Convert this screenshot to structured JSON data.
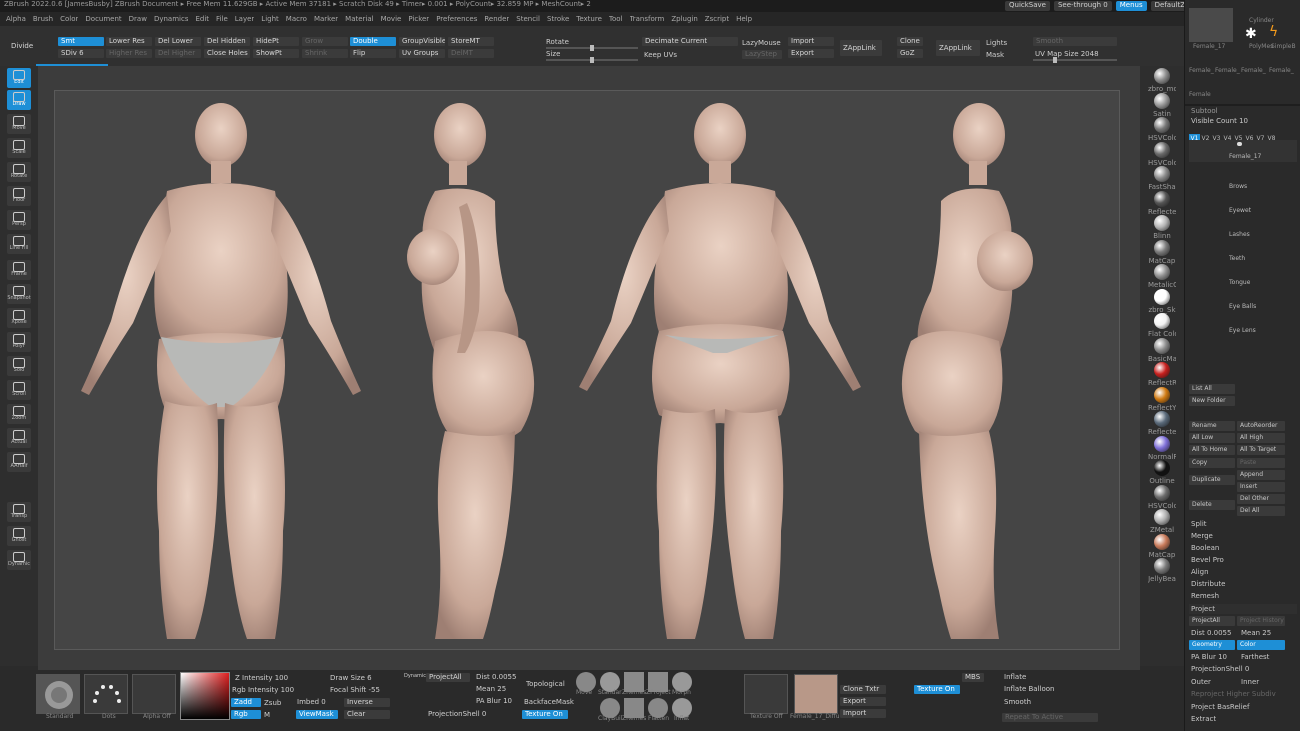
{
  "titlebar": {
    "title": "ZBrush 2022.0.6 [JamesBusby]   ZBrush Document      ▸ Free Mem 11.629GB ▸ Active Mem 37181 ▸ Scratch Disk 49 ▸ Timer▸ 0.001 ▸ PolyCount▸ 32.859 MP ▸ MeshCount▸ 2",
    "quicksave": "QuickSave",
    "seethrough": "See-through  0",
    "menus": "Menus",
    "script": "DefaultZScript"
  },
  "menubar": [
    "Alpha",
    "Brush",
    "Color",
    "Document",
    "Draw",
    "Dynamics",
    "Edit",
    "File",
    "Layer",
    "Light",
    "Macro",
    "Marker",
    "Material",
    "Movie",
    "Picker",
    "Preferences",
    "Render",
    "Stencil",
    "Stroke",
    "Texture",
    "Tool",
    "Transform",
    "Zplugin",
    "Zscript",
    "Help"
  ],
  "shelf": {
    "divide": "Divide",
    "smt": "Smt",
    "sdiv": "SDiv 6",
    "lower_res": "Lower Res",
    "higher_res": "Higher Res",
    "del_lower": "Del Lower",
    "del_higher": "Del Higher",
    "del_hidden": "Del Hidden",
    "close_holes": "Close Holes",
    "hidept": "HidePt",
    "showpt": "ShowPt",
    "grow": "Grow",
    "shrink": "Shrink",
    "double": "Double",
    "flip": "Flip",
    "groupvisible": "GroupVisible",
    "uvgroups": "Uv Groups",
    "storemt": "StoreMT",
    "delmt": "DelMT",
    "rotate": "Rotate",
    "size": "Size",
    "decimate": "Decimate Current",
    "keepuvs": "Keep UVs",
    "lazymouse": "LazyMouse",
    "lazystep": "LazyStep",
    "import": "Import",
    "export": "Export",
    "zapplink": "ZAppLink",
    "clone": "Clone",
    "goz": "GoZ",
    "zapplink2": "ZAppLink",
    "lights": "Lights",
    "mask": "Mask",
    "smooth": "Smooth",
    "uvmap": "UV Map Size 2048"
  },
  "lefttools": [
    "Edit",
    "Draw",
    "Move",
    "Scale",
    "Rotate",
    "Floor",
    "Persp",
    "Line Fill",
    "Frame",
    "Snapshot",
    "Xpose",
    "PolyF",
    "Solo",
    "Scroll",
    "Zoom",
    "Actual",
    "AAHalf",
    "Transp",
    "Ghost",
    "Dynamic"
  ],
  "materials": [
    {
      "name": "zbro_mo",
      "color": "#8c8c8c"
    },
    {
      "name": "Satin",
      "color": "#9a9a9a"
    },
    {
      "name": "HSVColo",
      "color": "#777777"
    },
    {
      "name": "HSVColo",
      "color": "#6a6a6a"
    },
    {
      "name": "FastSha",
      "color": "#8a8a8a"
    },
    {
      "name": "Reflecte",
      "color": "#555555"
    },
    {
      "name": "Blinn",
      "color": "#b5b5b5"
    },
    {
      "name": "MatCap",
      "color": "#7a7a7a"
    },
    {
      "name": "MetalicC",
      "color": "#909090"
    },
    {
      "name": "zbro_Sk",
      "color": "#ffffff"
    },
    {
      "name": "Flat Colo",
      "color": "#f2f2f2"
    },
    {
      "name": "BasicMa",
      "color": "#8a8a8a"
    },
    {
      "name": "ReflectR",
      "color": "#c8201e"
    },
    {
      "name": "ReflectY",
      "color": "#d07a12"
    },
    {
      "name": "Reflecte",
      "color": "#5a6a7a"
    },
    {
      "name": "NormalR",
      "color": "#7e6fd8"
    },
    {
      "name": "Outline",
      "color": "#111111"
    },
    {
      "name": "HSVColo",
      "color": "#6d6d6d"
    },
    {
      "name": "ZMetal",
      "color": "#b0b0b0"
    },
    {
      "name": "MatCap",
      "color": "#c87a5a"
    },
    {
      "name": "JellyBea",
      "color": "#7a7a7a"
    }
  ],
  "bottom": {
    "standard": "Standard",
    "dots": "Dots",
    "alpha_off": "Alpha Off",
    "z_intensity": "Z Intensity 100",
    "rgb_intensity": "Rgb Intensity 100",
    "zadd": "Zadd",
    "zsub": "Zsub",
    "rgb": "Rgb",
    "m": "M",
    "draw_size": "Draw Size 6",
    "dynamic": "Dynamic",
    "focal_shift": "Focal Shift -55",
    "imbed": "Imbed 0",
    "viewmask": "ViewMask",
    "inverse": "Inverse",
    "clear": "Clear",
    "projectall": "ProjectAll",
    "dist": "Dist 0.0055",
    "mean": "Mean 25",
    "pa_blur": "PA Blur 10",
    "projectionshell": "ProjectionShell 0",
    "topological": "Topological",
    "backfacemask": "BackfaceMask",
    "texture_on": "Texture On",
    "brushes": [
      "Move",
      "Standar",
      "ZRemes",
      "ZProject",
      "Morph",
      "ClayBuil",
      "ZRemes",
      "Flatten",
      "Inflat"
    ],
    "texture_off": "Texture Off",
    "texture_name": "Female_17_Diffu",
    "clone_txtr": "Clone Txtr",
    "export": "Export",
    "import": "Import",
    "texture_on2": "Texture On",
    "mbs": "MBS",
    "inflate": "Inflate",
    "inflate_balloon": "Inflate Balloon",
    "smooth": "Smooth",
    "repeat": "Repeat To Active"
  },
  "rightpanel": {
    "tool_thumbs": [
      "Female_17",
      "Cylinder",
      "PolyMes",
      "SimpleB",
      "Female_",
      "Female_",
      "Female_",
      "Female_",
      "Female"
    ],
    "subtool": "Subtool",
    "visible_count": "Visible Count 10",
    "vtabs": [
      "V1",
      "V2",
      "V3",
      "V4",
      "V5",
      "V6",
      "V7",
      "V8"
    ],
    "subtools": [
      "Female_17",
      "Brows",
      "Eyewet",
      "Lashes",
      "Teeth",
      "Tongue",
      "Eye Balls",
      "Eye Lens"
    ],
    "list_all": "List All",
    "new_folder": "New Folder",
    "rename": "Rename",
    "autoreorder": "AutoReorder",
    "all_low": "All Low",
    "all_high": "All High",
    "all_to_home": "All To Home",
    "all_to_target": "All To Target",
    "copy": "Copy",
    "paste": "Paste",
    "duplicate": "Duplicate",
    "append": "Append",
    "insert": "Insert",
    "delete": "Delete",
    "del_other": "Del Other",
    "del_all": "Del All",
    "split": "Split",
    "merge": "Merge",
    "boolean": "Boolean",
    "bevel_pro": "Bevel Pro",
    "align": "Align",
    "distribute": "Distribute",
    "remesh": "Remesh",
    "project": "Project",
    "projectall": "ProjectAll",
    "project_history": "Project History",
    "dist": "Dist 0.0055",
    "mean": "Mean 25",
    "geometry": "Geometry",
    "color": "Color",
    "pa_blur": "PA Blur 10",
    "farthest": "Farthest",
    "projectionshell": "ProjectionShell 0",
    "outer": "Outer",
    "inner": "Inner",
    "reproject": "Reproject Higher Subdiv",
    "project_basrelief": "Project BasRelief",
    "extract": "Extract"
  }
}
